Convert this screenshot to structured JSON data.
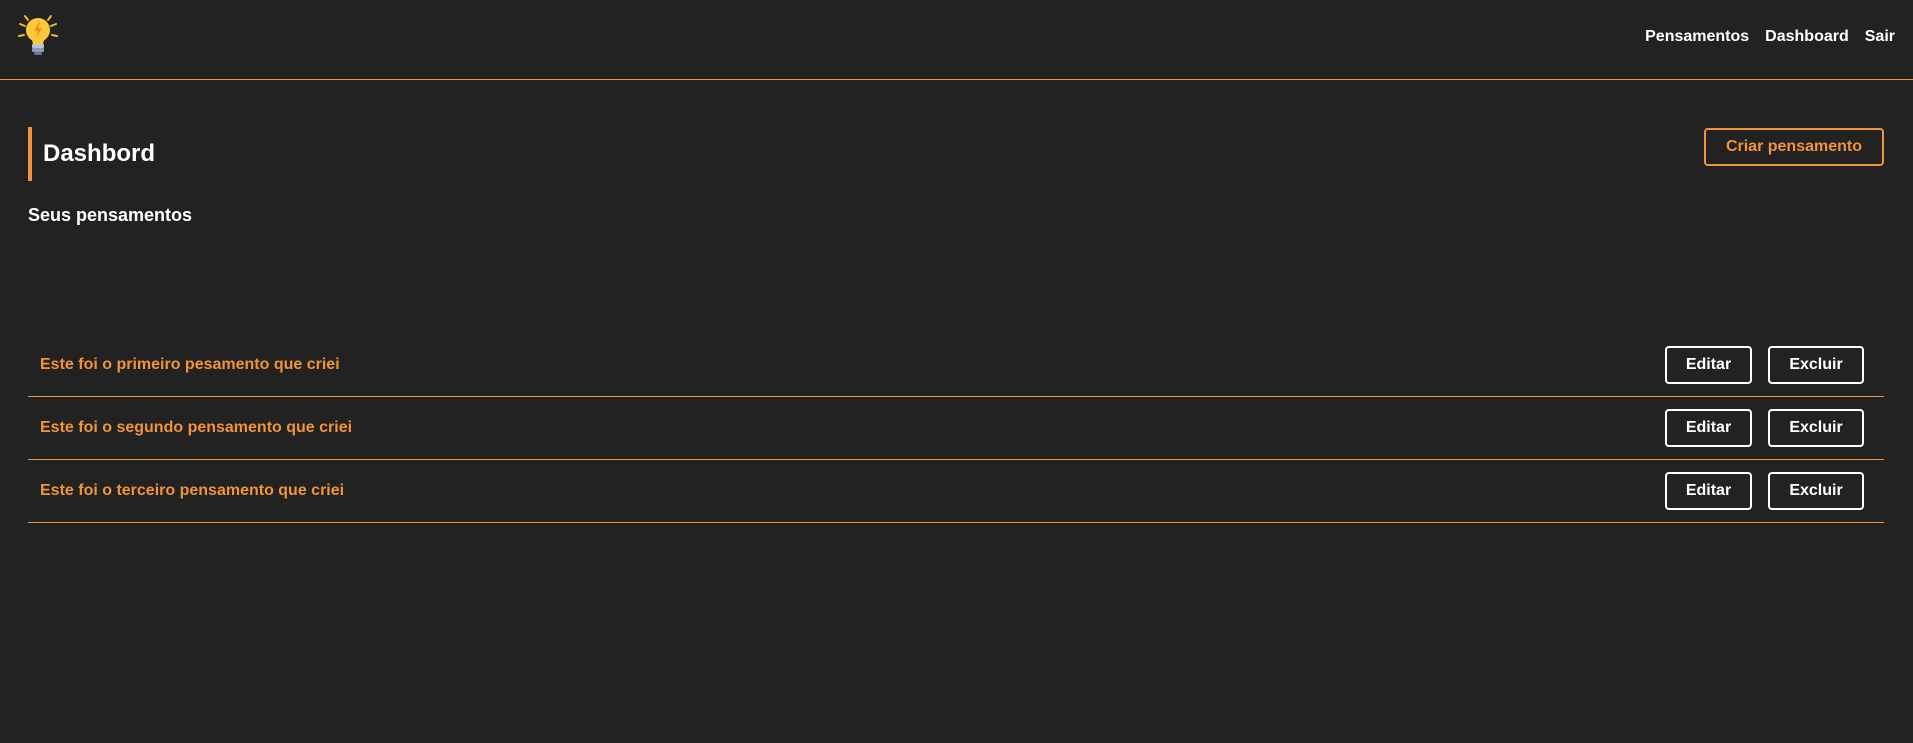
{
  "navbar": {
    "logo_icon": "lightbulb-icon",
    "links": [
      "Pensamentos",
      "Dashboard",
      "Sair"
    ]
  },
  "main": {
    "title": "Dashbord",
    "create_button": "Criar pensamento",
    "subtitle": "Seus pensamentos",
    "thoughts": [
      {
        "text": "Este foi o primeiro pesamento que criei",
        "edit": "Editar",
        "delete": "Excluir"
      },
      {
        "text": "Este foi o segundo pensamento que criei",
        "edit": "Editar",
        "delete": "Excluir"
      },
      {
        "text": "Este foi o terceiro pensamento que criei",
        "edit": "Editar",
        "delete": "Excluir"
      }
    ]
  },
  "colors": {
    "background": "#222222",
    "accent": "#f0933a",
    "text": "#ffffff"
  }
}
